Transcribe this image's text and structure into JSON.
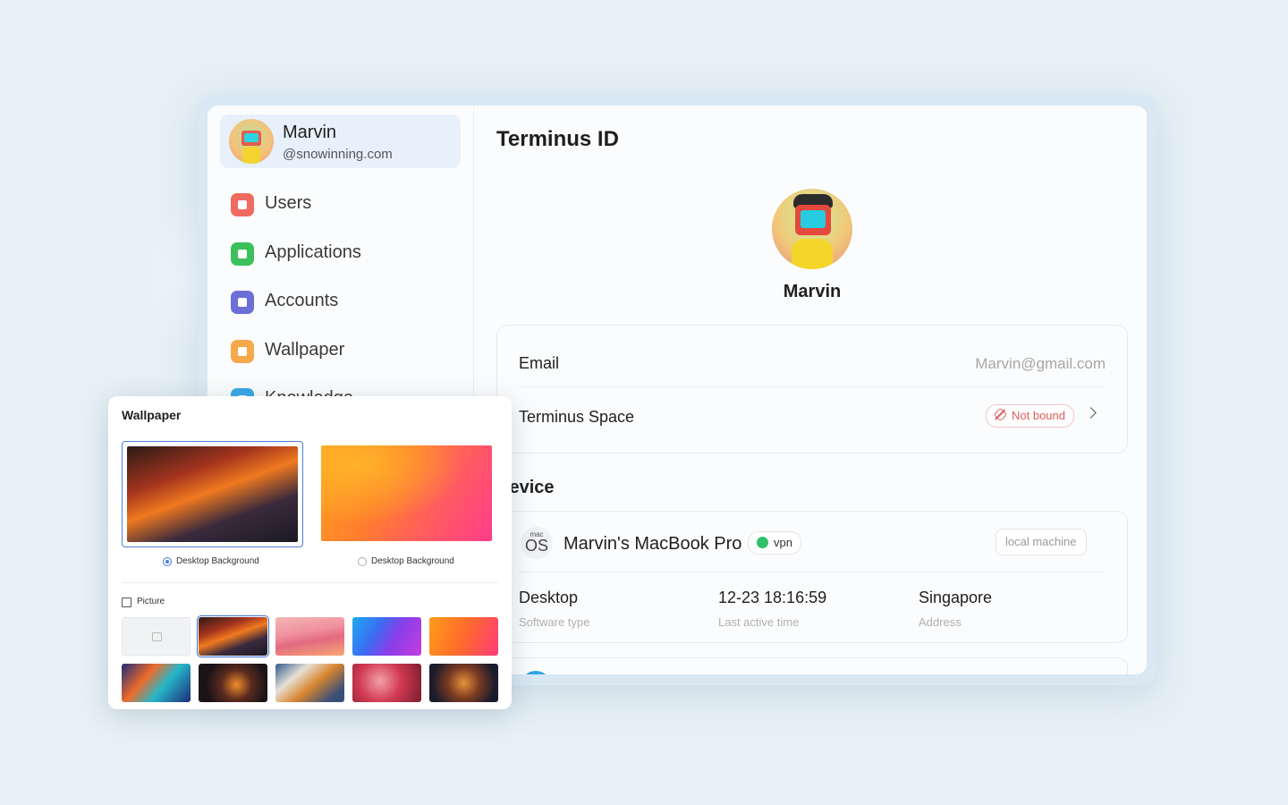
{
  "sidebar": {
    "profile": {
      "name": "Marvin",
      "handle": "@snowinning.com"
    },
    "items": [
      {
        "label": "Users",
        "icon": "users-icon",
        "color": "#f06a5f"
      },
      {
        "label": "Applications",
        "icon": "applications-icon",
        "color": "#3cc05c"
      },
      {
        "label": "Accounts",
        "icon": "accounts-icon",
        "color": "#6b6fd6"
      },
      {
        "label": "Wallpaper",
        "icon": "wallpaper-icon",
        "color": "#f5a94a"
      },
      {
        "label": "Knowledge",
        "icon": "knowledge-icon",
        "color": "#3aa7e6"
      }
    ]
  },
  "main": {
    "title": "Terminus ID",
    "user_name": "Marvin",
    "email_label": "Email",
    "email_value": "Marvin@gmail.com",
    "space_label": "Terminus Space",
    "space_status": "Not bound",
    "device_section_title": "Device",
    "device": {
      "os_small": "mac",
      "os_big": "OS",
      "name": "Marvin's MacBook Pro",
      "vpn_label": "vpn",
      "local_label": "local machine",
      "software_type_value": "Desktop",
      "software_type_label": "Software type",
      "last_active_value": "12-23 18:16:59",
      "last_active_label": "Last active time",
      "address_value": "Singapore",
      "address_label": "Address"
    }
  },
  "wallpaper_popup": {
    "title": "Wallpaper",
    "options": [
      {
        "label": "Desktop Background",
        "selected": true
      },
      {
        "label": "Desktop Background",
        "selected": false
      }
    ],
    "picture_label": "Picture"
  },
  "colors": {
    "accent": "#3f7ce0",
    "danger": "#e15b5b",
    "vpn_green": "#2fc06a"
  }
}
